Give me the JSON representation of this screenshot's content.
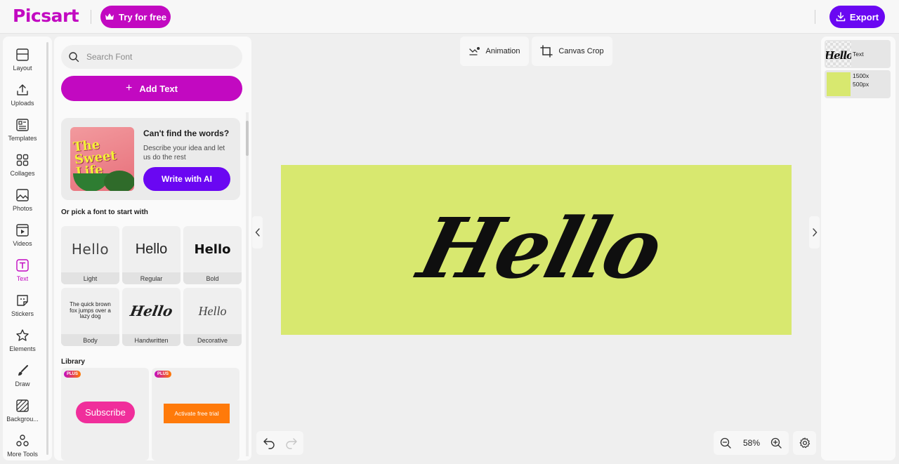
{
  "header": {
    "logo": "Picsart",
    "try_label": "Try for free",
    "export_label": "Export"
  },
  "rail": {
    "items": [
      {
        "label": "Layout",
        "icon": "layout-icon"
      },
      {
        "label": "Uploads",
        "icon": "upload-icon"
      },
      {
        "label": "Templates",
        "icon": "templates-icon"
      },
      {
        "label": "Collages",
        "icon": "collages-icon"
      },
      {
        "label": "Photos",
        "icon": "photos-icon"
      },
      {
        "label": "Videos",
        "icon": "videos-icon"
      },
      {
        "label": "Text",
        "icon": "text-icon"
      },
      {
        "label": "Stickers",
        "icon": "stickers-icon"
      },
      {
        "label": "Elements",
        "icon": "star-icon"
      },
      {
        "label": "Draw",
        "icon": "brush-icon"
      },
      {
        "label": "Backgrou...",
        "icon": "background-icon"
      },
      {
        "label": "More Tools",
        "icon": "more-tools-icon"
      }
    ]
  },
  "panel": {
    "search_placeholder": "Search Font",
    "add_text_label": "Add Text",
    "ai_card": {
      "thumb_text": "The Sweet Life",
      "title": "Can't find the words?",
      "description": "Describe your idea and let us do the rest",
      "button": "Write with AI"
    },
    "pick_label": "Or pick a font to start with",
    "fonts": [
      {
        "sample": "Hello",
        "caption": "Light"
      },
      {
        "sample": "Hello",
        "caption": "Regular"
      },
      {
        "sample": "Hello",
        "caption": "Bold"
      },
      {
        "sample": "The quick brown fox jumps over a lazy dog",
        "caption": "Body"
      },
      {
        "sample": "Hello",
        "caption": "Handwritten"
      },
      {
        "sample": "Hello",
        "caption": "Decorative"
      }
    ],
    "library_label": "Library",
    "library": [
      {
        "badge": "PLUS",
        "content": "Subscribe"
      },
      {
        "badge": "PLUS",
        "content": "Activate free trial"
      }
    ]
  },
  "toolbar": {
    "animation_label": "Animation",
    "crop_label": "Canvas Crop"
  },
  "canvas": {
    "text": "Hello",
    "background": "#d8e86f"
  },
  "zoom": {
    "value": "58%"
  },
  "layers": [
    {
      "name": "Text"
    },
    {
      "name": "1500x 500px"
    }
  ],
  "colors": {
    "brand": "#c209c1",
    "accent": "#6a07f2",
    "canvas": "#d8e86f"
  }
}
